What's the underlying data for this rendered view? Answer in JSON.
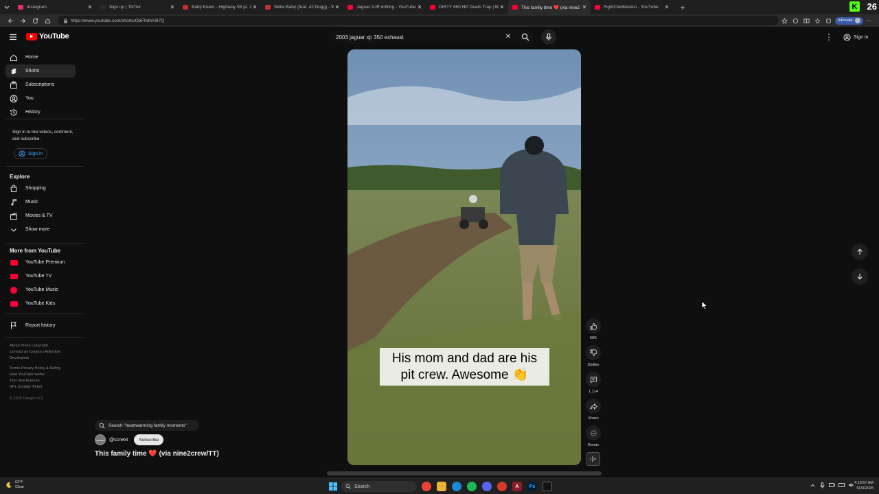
{
  "browser": {
    "tabs": [
      {
        "title": "Instagram",
        "favicon_color": "#e1306c",
        "active": false
      },
      {
        "title": "Sign up | TikTok",
        "favicon_color": "#2a2a2a",
        "active": false
      },
      {
        "title": "Baby Keem - Highway 95 pt. 2 (Official",
        "favicon_color": "#c4302b",
        "active": false
      },
      {
        "title": "Skilla Baby (feat. 42 Dugg) - Weird",
        "favicon_color": "#c4302b",
        "active": false
      },
      {
        "title": "Jaguar XJR drifting - YouTube",
        "favicon_color": "#ff0033",
        "active": false
      },
      {
        "title": "DIRTY 650 HP Death Trap | Big Tur",
        "favicon_color": "#ff0033",
        "active": false
      },
      {
        "title": "This family time ❤️ (via nine2",
        "favicon_color": "#ff0033",
        "active": true
      },
      {
        "title": "FightClubMexico - YouTube",
        "favicon_color": "#ff0033",
        "active": false
      }
    ],
    "url": "https://www.youtube.com/shorts/ObFRdhXi97Q",
    "inprivate_label": "InPrivate",
    "badge_letter": "K",
    "badge_number": "26"
  },
  "youtube": {
    "logo_text": "YouTube",
    "search_query": "2003 jaguar xjr 350 exhaust",
    "signin_label": "Sign in"
  },
  "sidebar": {
    "main": [
      {
        "label": "Home",
        "icon": "home-icon",
        "active": false
      },
      {
        "label": "Shorts",
        "icon": "shorts-icon",
        "active": true
      },
      {
        "label": "Subscriptions",
        "icon": "subscriptions-icon",
        "active": false
      },
      {
        "label": "You",
        "icon": "you-icon",
        "active": false
      },
      {
        "label": "History",
        "icon": "history-icon",
        "active": false
      }
    ],
    "signin_prompt": "Sign in to like videos, comment, and subscribe.",
    "signin_button": "Sign in",
    "explore_heading": "Explore",
    "explore": [
      {
        "label": "Shopping",
        "icon": "shopping-bag-icon"
      },
      {
        "label": "Music",
        "icon": "music-note-icon"
      },
      {
        "label": "Movies & TV",
        "icon": "clapperboard-icon"
      },
      {
        "label": "Show more",
        "icon": "chevron-down-icon"
      }
    ],
    "more_heading": "More from YouTube",
    "more": [
      {
        "label": "YouTube Premium",
        "icon": "youtube-premium-icon"
      },
      {
        "label": "YouTube TV",
        "icon": "youtube-tv-icon"
      },
      {
        "label": "YouTube Music",
        "icon": "youtube-music-icon"
      },
      {
        "label": "YouTube Kids",
        "icon": "youtube-kids-icon"
      }
    ],
    "report_history": "Report history",
    "footer": [
      "About  Press  Copyright",
      "Contact us  Creators  Advertise",
      "Developers",
      "Terms  Privacy  Policy & Safety",
      "How YouTube works",
      "Test new features",
      "NFL Sunday Ticket",
      "© 2025 Google LLC"
    ]
  },
  "short": {
    "caption": "His mom and dad are his pit crew. Awesome 👏",
    "actions": {
      "like_count": "50K",
      "dislike_label": "Dislike",
      "comment_count": "1,114",
      "share_label": "Share",
      "remix_label": "Remix"
    },
    "search_chip": "Search \"heartwarming family moments\"",
    "channel_name": "@scnext",
    "channel_avatar_text": "scnext",
    "subscribe_label": "Subscribe",
    "title": "This family time",
    "title_emoji": "❤️",
    "title_suffix": "(via nine2crew/TT)"
  },
  "taskbar": {
    "weather_temp": "62°F",
    "weather_desc": "Clear",
    "search_placeholder": "Search",
    "time": "4:10:57 AM",
    "date": "5/23/2025"
  },
  "colors": {
    "youtube_red": "#ff0000",
    "kick_green": "#53fc18",
    "background": "#0f0f0f",
    "link_blue": "#3ea6ff"
  }
}
